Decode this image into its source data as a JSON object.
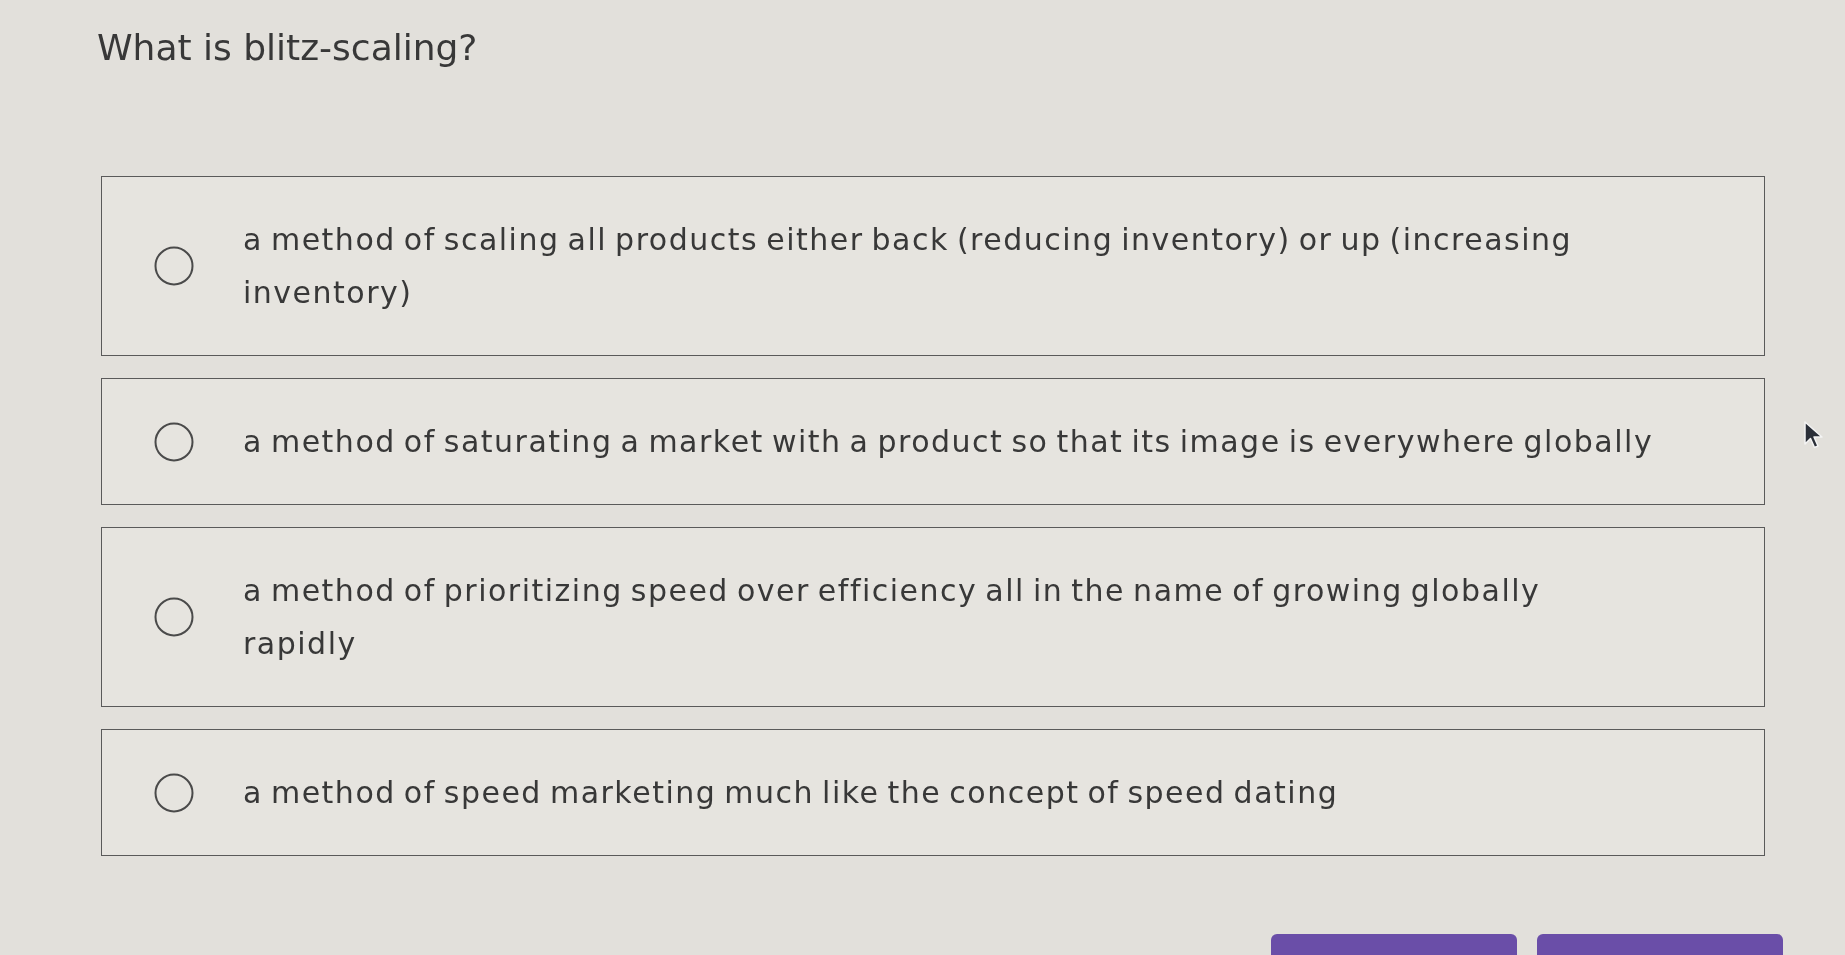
{
  "question": {
    "title": "What is blitz-scaling?"
  },
  "options": [
    {
      "text": "a method of scaling all products either back (reducing inventory) or up (increasing inventory)",
      "selected": false
    },
    {
      "text": "a method of saturating a market with a product so that its image is everywhere globally",
      "selected": false
    },
    {
      "text": "a method of prioritizing speed over efficiency all in the name of growing globally rapidly",
      "selected": false
    },
    {
      "text": "a method of speed marketing much like the concept of speed dating",
      "selected": false
    }
  ]
}
